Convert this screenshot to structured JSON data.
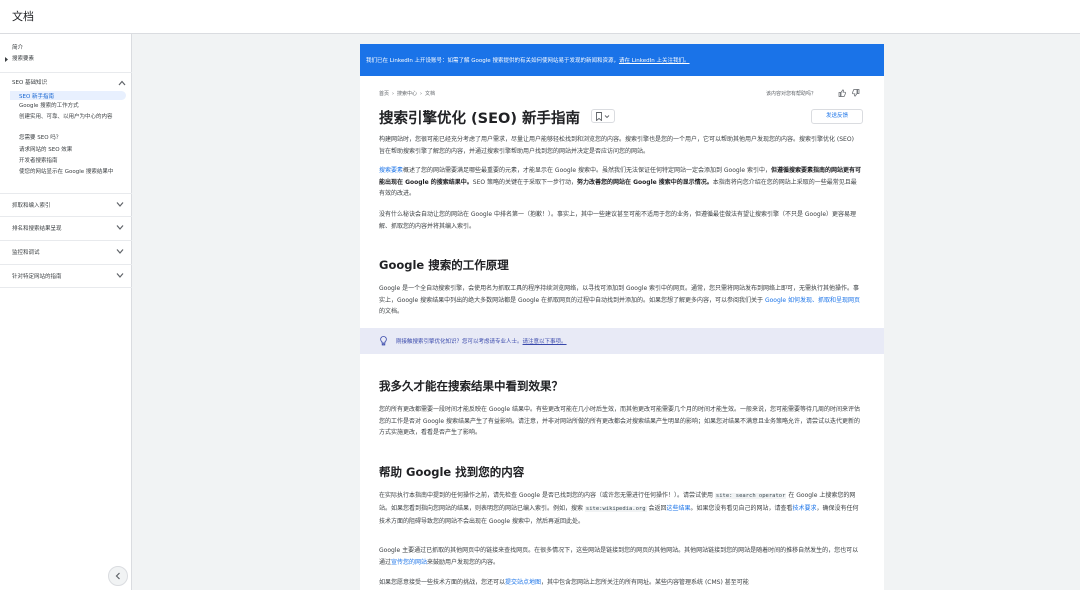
{
  "header": {
    "title": "文档"
  },
  "sidebar": {
    "top_links": [
      "简介",
      "搜索要素"
    ],
    "section_open": "SEO 基础知识",
    "active_item": "SEO 新手指南",
    "sub_items": [
      "Google 搜索的工作方式",
      "创建实用、可靠、以用户为中心的内容",
      "您需要 SEO 吗？",
      "请求网站的 SEO 效果",
      "开发者搜索指南",
      "使您的网站显示在 Google 搜索结果中"
    ],
    "sections": [
      "抓取和编入索引",
      "排名和搜索结果呈现",
      "监控和调试",
      "针对特定网站的指南"
    ]
  },
  "banner": {
    "text": "我们已在 LinkedIn 上开设账号：如需了解 Google 搜索提供的有关如何使网站易于发现的新闻和资源，",
    "link": "请在 LinkedIn 上关注我们。"
  },
  "breadcrumb": [
    "首页",
    "搜索中心",
    "文档"
  ],
  "helpful_label": "该内容对您有帮助吗？",
  "page_title": "搜索引擎优化 (SEO) 新手指南",
  "feedback_button": "发送反馈",
  "intro": {
    "p1": "构建网站时，您很可能已经充分考虑了用户需求，尽量让用户能够轻松找到和浏览您的内容。搜索引擎也是您的一个用户，它可以帮助其他用户发现您的内容。搜索引擎优化 (SEO) 旨在帮助搜索引擎了解您的内容，并通过搜索引擎帮助用户找到您的网站并决定是否应访问您的网站。",
    "p2_link": "搜索要素",
    "p2_a": "概述了您的网站需要满足哪些最重要的元素，才能显示在 Google 搜索中。虽然我们无法保证任何特定网站一定会添加到 Google 索引中，",
    "p2_bold1": "但遵循搜索要素指南的网站更有可能出现在 Google 的搜索结果中。",
    "p2_b": "SEO 策略的关键在于采取下一步行动，",
    "p2_bold2": "努力改善您的网站在 Google 搜索中的显示情况。",
    "p2_c": "本指南将向您介绍在您的网站上采取的一些最常见且最有效的改进。",
    "p3": "没有什么秘诀会自动让您的网站在 Google 中排名第一（抱歉！）。事实上，其中一些建议甚至可能不适用于您的业务，但遵循最佳做法有望让搜索引擎（不只是 Google）更容易理解、抓取您的内容并将其编入索引。"
  },
  "section1": {
    "heading": "Google 搜索的工作原理",
    "body": "Google 是一个全自动搜索引擎，会使用名为抓取工具的程序持续浏览网络，以寻找可添加到 Google 索引中的网页。通常，您只需将网站发布到网络上即可，无需执行其他操作。事实上，Google 搜索结果中列出的绝大多数网站都是 Google 在抓取网页的过程中自动找到并添加的。如果您想了解更多内容，可以参阅我们关于 ",
    "link": "Google 如何发现、抓取和呈现网页",
    "tail": "的文档。"
  },
  "callout": {
    "q": "刚接触搜索引擎优化知识？",
    "mid": "您可以考虑请专业人士。",
    "link": "请注意以下事项。"
  },
  "section2": {
    "heading": "我多久才能在搜索结果中看到效果？",
    "body": "您的所有更改都需要一段时间才能反映在 Google 结果中。有些更改可能在几小时后生效，而其他更改可能需要几个月的时间才能生效。一般来说，您可能需要等待几周的时间来评估您的工作是否对 Google 搜索结果产生了有益影响。请注意，并非对网站所做的所有更改都会对搜索结果产生明显的影响；如果您对结果不满意且业务策略允许，请尝试以迭代更新的方式实施更改，看看是否产生了影响。"
  },
  "section3": {
    "heading": "帮助 Google 找到您的内容",
    "p1_a": "在实际执行本指南中提到的任何操作之前，请先检查 Google 是否已找到您的内容（或许您无需进行任何操作！）。请尝试使用 ",
    "code1": "site: search operator",
    "p1_b": " 在 Google 上搜索您的网站。如果您看到指向您网站的结果，则表明您的网站已编入索引。例如，搜索 ",
    "code2": "site:wikipedia.org",
    "p1_c": " 会返回",
    "p1_link1": "这些结果",
    "p1_d": "。如果您没有看见自己的网站，请查看",
    "p1_link2": "技术要求",
    "p1_e": "，确保没有任何技术方面的阻碍导致您的网站不会出现在 Google 搜索中，然后再返回此处。",
    "p2_a": "Google 主要通过已抓取的其他网页中的链接来查找网页。在很多情况下，这些网站是链接到您的网页的其他网站。其他网站链接到您的网站是随着时间的推移自然发生的，您也可以通过",
    "p2_link": "宣传您的网站",
    "p2_b": "来鼓励用户发现您的内容。",
    "p3_a": "如果您愿意接受一些技术方面的挑战，您还可以",
    "p3_link": "提交站点地图",
    "p3_b": "，其中包含您网站上您所关注的所有网址。某些内容管理系统 (CMS) 甚至可能"
  },
  "colors": {
    "accent": "#1a73e8",
    "banner": "#1a73e8",
    "callout_bg": "#e8eaf6",
    "page_bg": "#f1f3f4"
  },
  "icons": [
    "chevron-up-icon",
    "chevron-down-icon",
    "thumb-up-icon",
    "thumb-down-icon",
    "bookmark-icon",
    "lightbulb-icon",
    "chevron-left-icon"
  ]
}
